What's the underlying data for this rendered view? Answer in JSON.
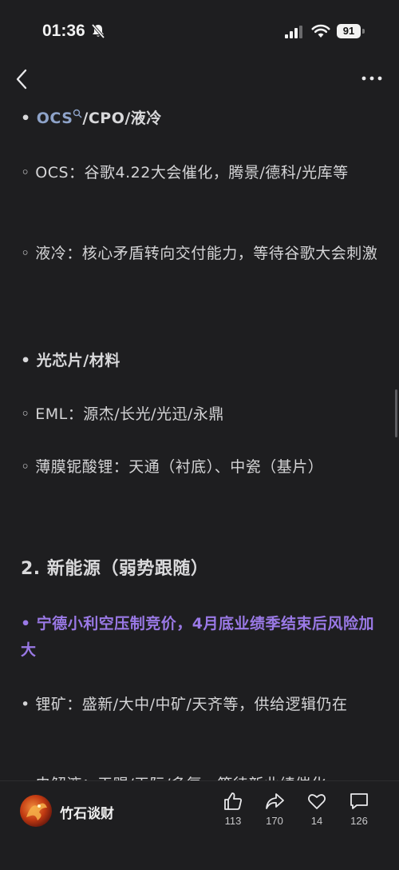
{
  "status": {
    "time": "01:36",
    "battery": "91"
  },
  "article": {
    "p1_lead": "• ",
    "p1_ocs": "OCS",
    "p1_rest": "/CPO/液冷",
    "p2": "◦ OCS：谷歌4.22大会催化，腾景/德科/光库等",
    "p3": "◦ 液冷：核心矛盾转向交付能力，等待谷歌大会刺激",
    "p4": "• 光芯片/材料",
    "p5": "◦ EML：源杰/长光/光迅/永鼎",
    "p6": "◦ 薄膜铌酸锂：天通（衬底）、中瓷（基片）",
    "h2": "2. 新能源（弱势跟随）",
    "p7": "• 宁德小利空压制竞价，4月底业绩季结束后风险加大",
    "p8": "• 锂矿：盛新/大中/中矿/天齐等，供给逻辑仍在",
    "p9": "• 电解液：天赐/天际/多氟，等待新业绩催化"
  },
  "footer": {
    "author": "竹石谈财",
    "likes": "113",
    "shares": "170",
    "favorites": "14",
    "comments": "126"
  }
}
